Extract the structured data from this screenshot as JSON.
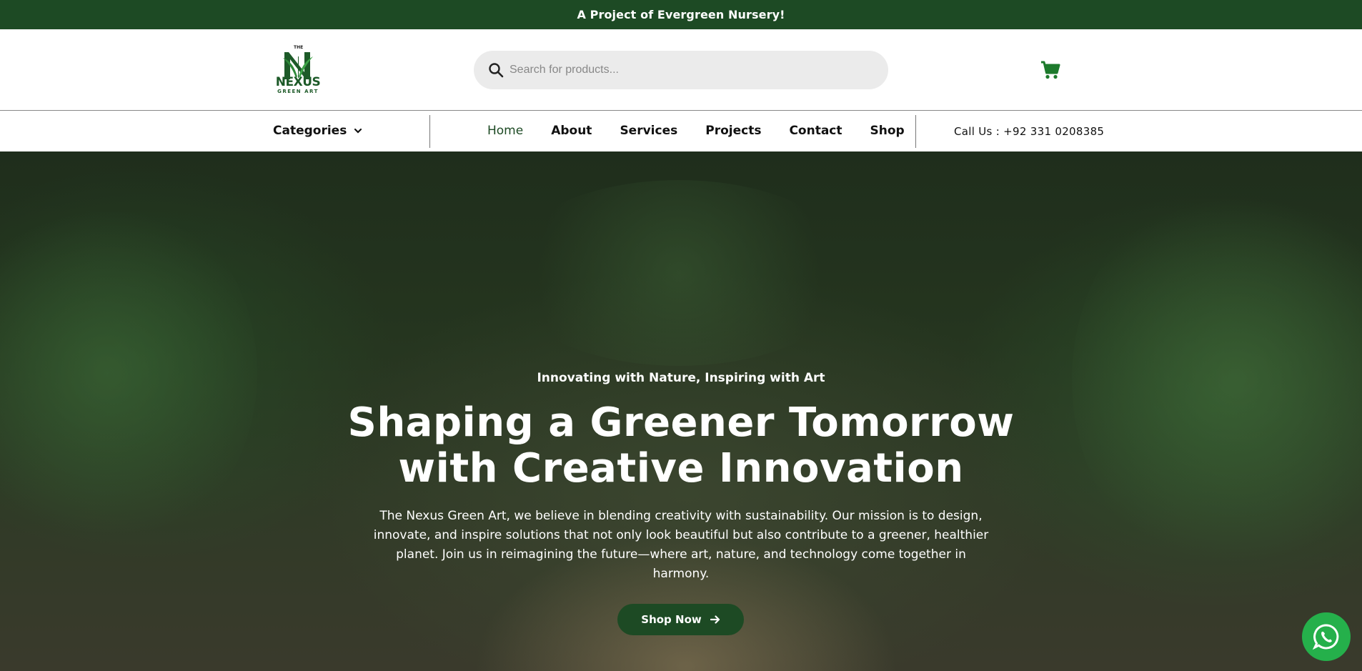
{
  "topbar": {
    "text": "A Project of Evergreen Nursery!"
  },
  "brand": {
    "the": "THE",
    "name": "NEXUS",
    "tagline": "GREEN ART",
    "color": "#1d5a28"
  },
  "search": {
    "placeholder": "Search for products...",
    "value": ""
  },
  "cart": {
    "icon": "cart-icon"
  },
  "nav": {
    "categories_label": "Categories",
    "items": [
      {
        "label": "Home",
        "active": true
      },
      {
        "label": "About"
      },
      {
        "label": "Services"
      },
      {
        "label": "Projects"
      },
      {
        "label": "Contact"
      },
      {
        "label": "Shop"
      }
    ],
    "call_us": "Call Us : +92 331 0208385"
  },
  "hero": {
    "subtitle": "Innovating with Nature, Inspiring with Art",
    "title_line1": "Shaping a Greener Tomorrow",
    "title_line2": "with Creative Innovation",
    "text": "The Nexus Green Art, we believe in blending creativity with sustainability. Our mission is to design, innovate, and inspire solutions that not only look beautiful but also contribute to a greener, healthier planet. Join us in reimagining the future—where art, nature, and technology come together in harmony.",
    "button_label": "Shop Now"
  },
  "colors": {
    "primary": "#1d4a24",
    "accent": "#1d7a2c",
    "whatsapp": "#25b04b"
  },
  "whatsapp": {
    "icon": "whatsapp-icon"
  }
}
